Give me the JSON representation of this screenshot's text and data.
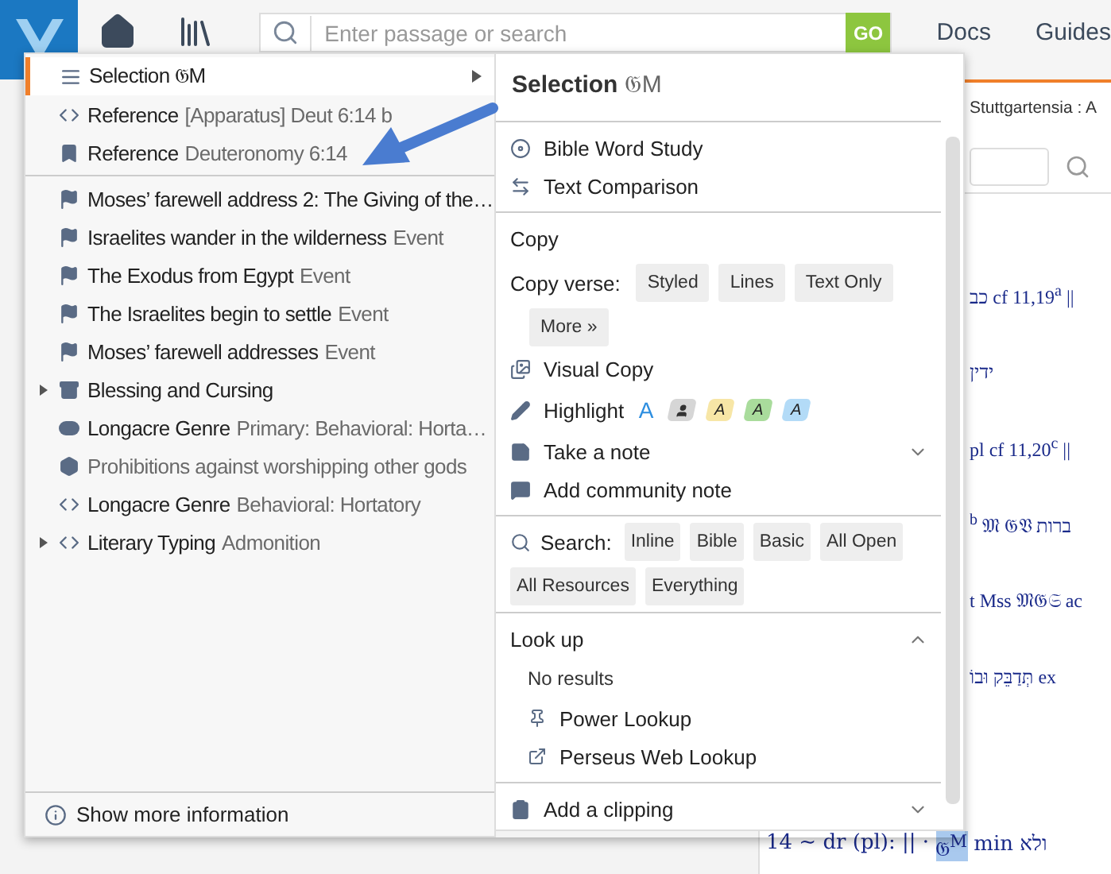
{
  "header": {
    "search_placeholder": "Enter passage or search",
    "go_button": "GO",
    "nav": [
      {
        "label": "Docs"
      },
      {
        "label": "Guides"
      }
    ]
  },
  "document": {
    "title": "Stuttgartensia : A",
    "lines": [
      {
        "text": "כב cf 11,19$^{a}$ ||"
      },
      {
        "text": "ידין"
      },
      {
        "text": "pl cf 11,20$^{c}$ ||"
      },
      {
        "text": "$^{b}$ 𝔐 𝔊𝔙 ברות"
      },
      {
        "text": "t Mss 𝔐𝔊𝔖 ac"
      },
      {
        "text": "תְּדַבֵּק וּבוֹ ex"
      }
    ],
    "last_line": {
      "before": "14 ~ dr (pl): || ·",
      "highlighted": "𝔊$^{M}$",
      "after": "min ולא"
    }
  },
  "context_menu": {
    "items": [
      {
        "kind": "selection",
        "label": "Selection 𝔊M",
        "selected": true,
        "expandable": false
      },
      {
        "kind": "reference",
        "label": "Reference",
        "detail": "[Apparatus] Deut 6:14 b",
        "selected": false,
        "expandable": false
      },
      {
        "kind": "bookmark",
        "label": "Reference",
        "detail": "Deuteronomy 6:14",
        "selected": false,
        "expandable": false,
        "divider_after": true
      },
      {
        "kind": "event",
        "label": "Moses’ farewell address 2: The Giving of the…",
        "selected": false,
        "expandable": false
      },
      {
        "kind": "event",
        "label": "Israelites wander in the wilderness",
        "detail": "Event",
        "selected": false,
        "expandable": false
      },
      {
        "kind": "event",
        "label": "The Exodus from Egypt",
        "detail": "Event",
        "selected": false,
        "expandable": false
      },
      {
        "kind": "event",
        "label": "The Israelites begin to settle",
        "detail": "Event",
        "selected": false,
        "expandable": false
      },
      {
        "kind": "event",
        "label": "Moses’ farewell addresses",
        "detail": "Event",
        "selected": false,
        "expandable": false
      },
      {
        "kind": "group",
        "label": "Blessing and Cursing",
        "selected": false,
        "expandable": true
      },
      {
        "kind": "genre",
        "label": "Longacre Genre",
        "detail": "Primary: Behavioral: Horta…",
        "selected": false,
        "expandable": false
      },
      {
        "kind": "topic",
        "detail": "Prohibitions against worshipping other gods",
        "selected": false,
        "expandable": false
      },
      {
        "kind": "reference",
        "label": "Longacre Genre",
        "detail": "Behavioral: Hortatory",
        "selected": false,
        "expandable": false
      },
      {
        "kind": "reference",
        "label": "Literary Typing",
        "detail": "Admonition",
        "selected": false,
        "expandable": true
      }
    ],
    "footer": "Show more information"
  },
  "detail_panel": {
    "title": "Selection",
    "title_tag": "𝔊M",
    "tools": [
      {
        "label": "Bible Word Study"
      },
      {
        "label": "Text Comparison"
      }
    ],
    "copy": {
      "heading": "Copy",
      "verse_label": "Copy verse:",
      "formats": [
        "Styled",
        "Lines",
        "Text Only",
        "More »"
      ],
      "visual_copy": "Visual Copy",
      "highlight": {
        "label": "Highlight",
        "styles": [
          {
            "kind": "text",
            "letter": "A",
            "color": "#2d8ee0"
          },
          {
            "kind": "person",
            "color": "#d6d6d6"
          },
          {
            "kind": "tag",
            "letter": "A",
            "color": "#f7e6a6"
          },
          {
            "kind": "tag",
            "letter": "A",
            "color": "#a9dc9c"
          },
          {
            "kind": "tag",
            "letter": "A",
            "color": "#b3dbf7"
          }
        ]
      },
      "note": {
        "label": "Take a note",
        "expanded": false
      },
      "community_note": "Add community note"
    },
    "search": {
      "label": "Search:",
      "scopes": [
        "Inline",
        "Bible",
        "Basic",
        "All Open",
        "All Resources",
        "Everything"
      ]
    },
    "lookup": {
      "heading": "Look up",
      "expanded": true,
      "status": "No results",
      "items": [
        "Power Lookup",
        "Perseus Web Lookup"
      ]
    },
    "clipping": {
      "label": "Add a clipping",
      "expanded": false
    }
  }
}
